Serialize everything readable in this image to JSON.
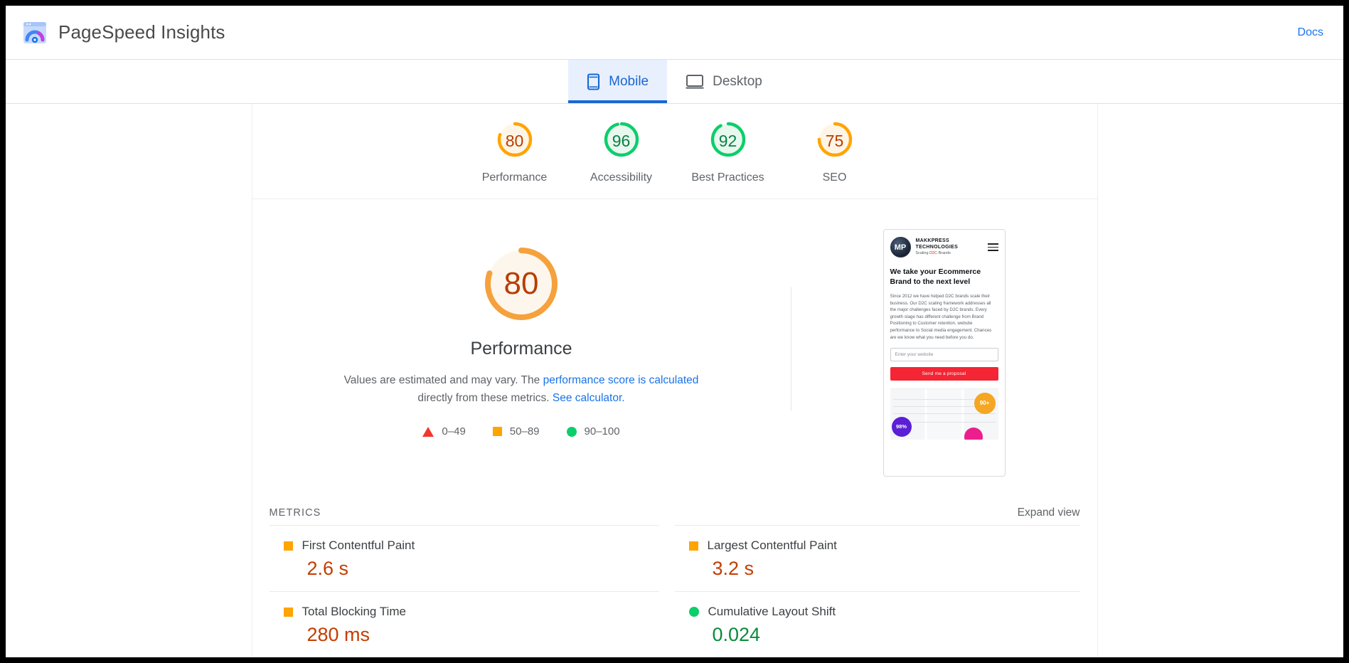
{
  "header": {
    "brand_title": "PageSpeed Insights",
    "logo_icon": "pagespeed-gauge-icon",
    "docs_label": "Docs"
  },
  "tabs": [
    {
      "label": "Mobile",
      "icon": "mobile-phone-icon",
      "active": true
    },
    {
      "label": "Desktop",
      "icon": "desktop-monitor-icon",
      "active": false
    }
  ],
  "scores": [
    {
      "label": "Performance",
      "value": "80",
      "pct": 80,
      "color": "#ffa400",
      "text_color": "#b93d00",
      "fill": "#fff5e6"
    },
    {
      "label": "Accessibility",
      "value": "96",
      "pct": 96,
      "color": "#0cce6b",
      "text_color": "#0b8043",
      "fill": "#e8f8ef"
    },
    {
      "label": "Best Practices",
      "value": "92",
      "pct": 92,
      "color": "#0cce6b",
      "text_color": "#0b8043",
      "fill": "#e8f8ef"
    },
    {
      "label": "SEO",
      "value": "75",
      "pct": 75,
      "color": "#ffa400",
      "text_color": "#b93d00",
      "fill": "#fff5e6"
    }
  ],
  "performance": {
    "score": "80",
    "pct": 80,
    "title": "Performance",
    "desc_part1": "Values are estimated and may vary. The ",
    "desc_link1": "performance score is calculated",
    "desc_part2": " directly from these metrics. ",
    "desc_link2": "See calculator.",
    "legend": [
      {
        "shape": "triangle",
        "label": "0–49",
        "color": "#f1382e"
      },
      {
        "shape": "square",
        "label": "50–89",
        "color": "#ffa400"
      },
      {
        "shape": "circle",
        "label": "90–100",
        "color": "#0cce6b"
      }
    ]
  },
  "thumbnail": {
    "logo_mark": "MP",
    "brand_line1": "MAKKPRESS",
    "brand_line2": "TECHNOLOGIES",
    "tagline_pre": "Scaling ",
    "tagline_mark": "D2C",
    "tagline_post": " Brands",
    "headline": "We take your Ecommerce Brand to the next level",
    "body": "Since 2012 we have helped D2C brands scale their business. Our D2C scaling framework addresses all the major challenges faced by D2C brands. Every growth stage has different challenge from Brand Positioning to Customer retention, website performance to Social media engagement. Chances are we know what you need before you do.",
    "input_placeholder": "Enter your website",
    "cta_label": "Send me a proposal",
    "badge1": "90+",
    "badge2": "98%",
    "badge3": ""
  },
  "metrics_section": {
    "title": "METRICS",
    "expand_label": "Expand view",
    "items": [
      {
        "name": "First Contentful Paint",
        "value": "2.6 s",
        "shape": "square",
        "value_color": "#c33d00"
      },
      {
        "name": "Largest Contentful Paint",
        "value": "3.2 s",
        "shape": "square",
        "value_color": "#c33d00"
      },
      {
        "name": "Total Blocking Time",
        "value": "280 ms",
        "shape": "square",
        "value_color": "#c33d00"
      },
      {
        "name": "Cumulative Layout Shift",
        "value": "0.024",
        "shape": "circle",
        "value_color": "#0a8a3c"
      }
    ]
  }
}
